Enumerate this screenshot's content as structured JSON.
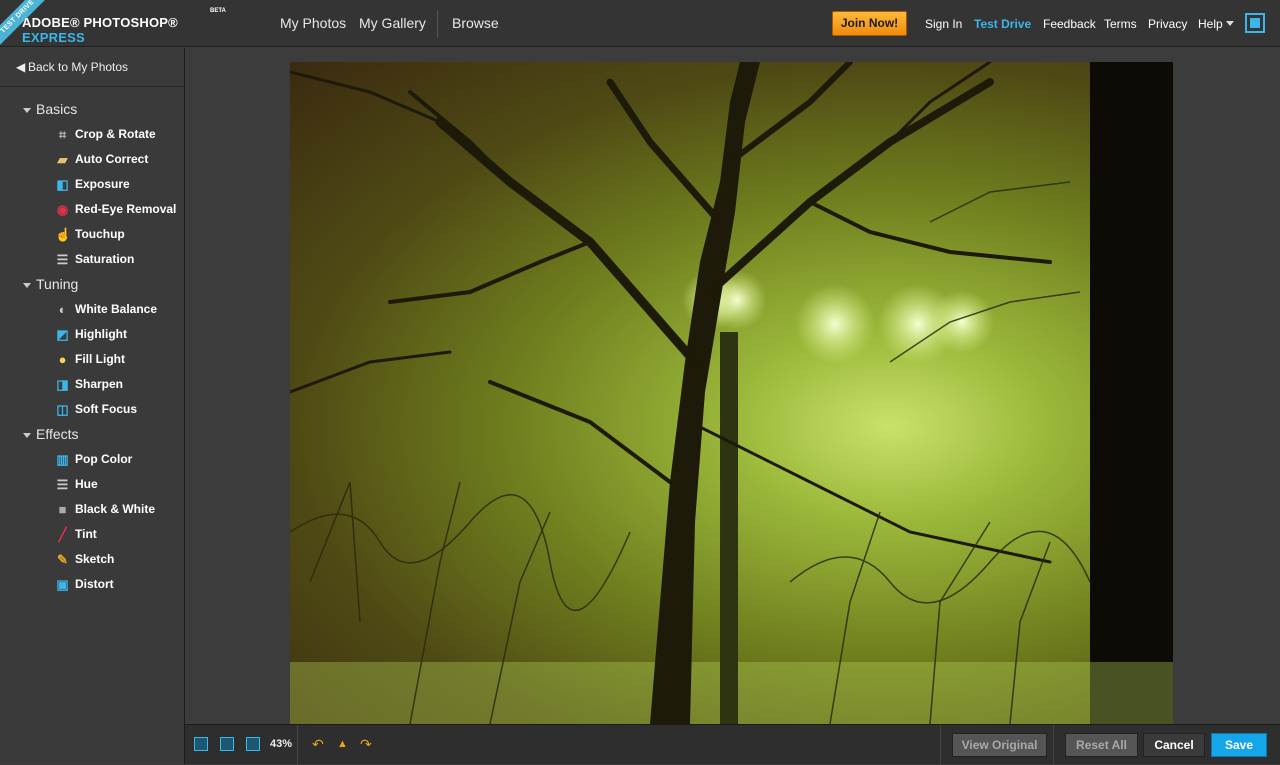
{
  "header": {
    "ribbon": "TEST DRIVE",
    "brand_main": "ADOBE® PHOTOSHOP®",
    "brand_accent": "EXPRESS",
    "beta": "BETA",
    "nav": [
      "My Photos",
      "My Gallery",
      "Browse"
    ],
    "join": "Join Now!",
    "sign_in": "Sign In",
    "test_drive": "Test Drive",
    "feedback": "Feedback",
    "terms": "Terms",
    "privacy": "Privacy",
    "help": "Help",
    "accent_color": "#3cb6e8"
  },
  "sidebar": {
    "back": "Back to My Photos",
    "sections": [
      {
        "title": "Basics",
        "tools": [
          {
            "label": "Crop & Rotate",
            "icon": "crop-icon"
          },
          {
            "label": "Auto Correct",
            "icon": "bandage-icon"
          },
          {
            "label": "Exposure",
            "icon": "exposure-icon"
          },
          {
            "label": "Red-Eye Removal",
            "icon": "red-eye-icon"
          },
          {
            "label": "Touchup",
            "icon": "hand-icon"
          },
          {
            "label": "Saturation",
            "icon": "saturation-icon"
          }
        ]
      },
      {
        "title": "Tuning",
        "tools": [
          {
            "label": "White Balance",
            "icon": "white-balance-icon"
          },
          {
            "label": "Highlight",
            "icon": "highlight-icon"
          },
          {
            "label": "Fill Light",
            "icon": "bulb-icon"
          },
          {
            "label": "Sharpen",
            "icon": "sharpen-icon"
          },
          {
            "label": "Soft Focus",
            "icon": "soft-focus-icon"
          }
        ]
      },
      {
        "title": "Effects",
        "tools": [
          {
            "label": "Pop Color",
            "icon": "pop-color-icon"
          },
          {
            "label": "Hue",
            "icon": "hue-icon"
          },
          {
            "label": "Black & White",
            "icon": "black-white-icon"
          },
          {
            "label": "Tint",
            "icon": "tint-icon"
          },
          {
            "label": "Sketch",
            "icon": "pencil-icon"
          },
          {
            "label": "Distort",
            "icon": "distort-icon"
          }
        ]
      }
    ]
  },
  "footer": {
    "zoom": "43%",
    "view_original": "View Original",
    "reset_all": "Reset All",
    "cancel": "Cancel",
    "save": "Save"
  }
}
